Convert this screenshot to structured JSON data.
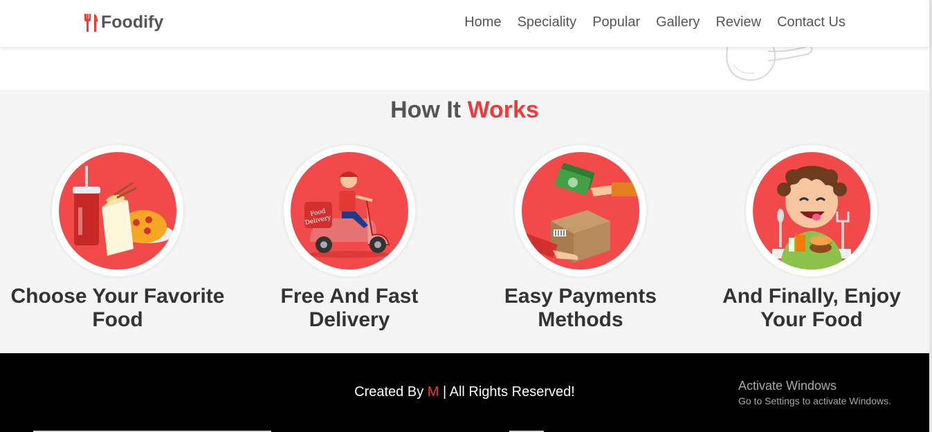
{
  "nav": {
    "logo_text": "Foodify",
    "links": [
      "Home",
      "Speciality",
      "Popular",
      "Gallery",
      "Review",
      "Contact Us"
    ]
  },
  "how_it_works": {
    "title_part1": "How It ",
    "title_part2": "Works",
    "steps": [
      {
        "title": "Choose Your Favorite Food",
        "icon": "food-combo-icon"
      },
      {
        "title": "Free And Fast Delivery",
        "icon": "delivery-scooter-icon"
      },
      {
        "title": "Easy Payments Methods",
        "icon": "payment-exchange-icon"
      },
      {
        "title": "And Finally, Enjoy Your Food",
        "icon": "happy-eater-icon"
      }
    ]
  },
  "footer": {
    "created_by": "Created By ",
    "author": "M",
    "rights": " | All Rights Reserved!"
  },
  "windows_watermark": {
    "title": "Activate Windows",
    "subtitle": "Go to Settings to activate Windows."
  },
  "colors": {
    "accent": "#f03a3a",
    "circle": "#f24a4a",
    "section_bg": "#f5f5f5",
    "footer_bg": "#000000"
  }
}
